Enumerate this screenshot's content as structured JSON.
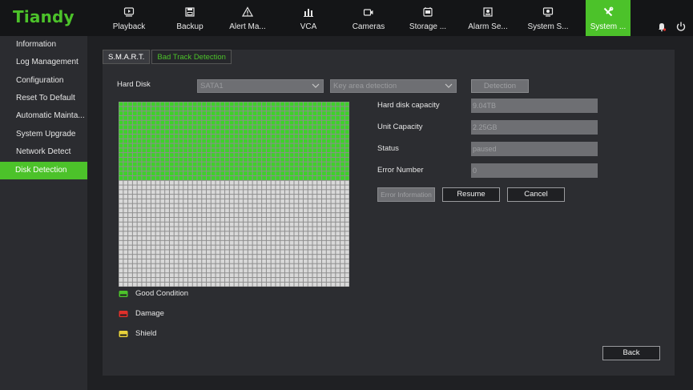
{
  "brand": "Tiandy",
  "nav": [
    {
      "label": "Playback",
      "icon": "playback-icon"
    },
    {
      "label": "Backup",
      "icon": "backup-icon"
    },
    {
      "label": "Alert Ma...",
      "icon": "alert-icon"
    },
    {
      "label": "VCA",
      "icon": "vca-icon"
    },
    {
      "label": "Cameras",
      "icon": "camera-icon"
    },
    {
      "label": "Storage ...",
      "icon": "storage-icon"
    },
    {
      "label": "Alarm Se...",
      "icon": "alarm-icon"
    },
    {
      "label": "System S...",
      "icon": "system-status-icon"
    },
    {
      "label": "System ...",
      "icon": "system-settings-icon",
      "active": true
    }
  ],
  "sidebar": [
    {
      "label": "Information"
    },
    {
      "label": "Log Management"
    },
    {
      "label": "Configuration"
    },
    {
      "label": "Reset To Default"
    },
    {
      "label": "Automatic Mainta..."
    },
    {
      "label": "System Upgrade"
    },
    {
      "label": "Network Detect"
    },
    {
      "label": "Disk Detection",
      "active": true
    }
  ],
  "tabs": [
    {
      "label": "S.M.A.R.T.",
      "active": true
    },
    {
      "label": "Bad Track Detection",
      "active": false
    }
  ],
  "form": {
    "hard_disk_label": "Hard Disk",
    "hard_disk_value": "SATA1",
    "mode_value": "Key area detection",
    "detection_label": "Detection",
    "capacity_label": "Hard disk capacity",
    "capacity_value": "9.04TB",
    "unit_label": "Unit Capacity",
    "unit_value": "2.25GB",
    "status_label": "Status",
    "status_value": "paused",
    "error_label": "Error Number",
    "error_value": "0",
    "error_info_label": "Error Information",
    "resume_label": "Resume",
    "cancel_label": "Cancel",
    "back_label": "Back"
  },
  "legend": [
    {
      "label": "Good Condition",
      "color": "#4cc22a"
    },
    {
      "label": "Damage",
      "color": "#e0302a"
    },
    {
      "label": "Shield",
      "color": "#e8d23a"
    }
  ],
  "grid_progress": {
    "rows": 40,
    "cols": 50,
    "good_cells": 850
  },
  "colors": {
    "accent": "#4cc22a",
    "cell_good": "#3ed12a",
    "cell_empty": "#d9d9d9"
  }
}
